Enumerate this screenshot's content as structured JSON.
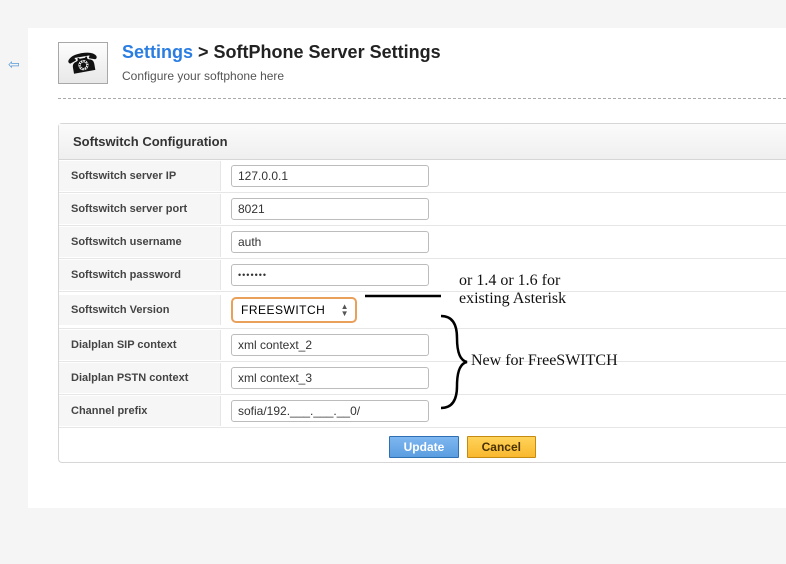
{
  "nav": {
    "back_icon": "⇦"
  },
  "header": {
    "breadcrumb_link": "Settings",
    "breadcrumb_sep": " > ",
    "breadcrumb_page": "SoftPhone Server Settings",
    "subtitle": "Configure your softphone here",
    "icon": "phone-icon"
  },
  "panel": {
    "title": "Softswitch Configuration"
  },
  "fields": {
    "server_ip": {
      "label": "Softswitch server IP",
      "value": "127.0.0.1"
    },
    "server_port": {
      "label": "Softswitch server port",
      "value": "8021"
    },
    "username": {
      "label": "Softswitch username",
      "value": "auth"
    },
    "password": {
      "label": "Softswitch password",
      "value": "•••••••"
    },
    "version": {
      "label": "Softswitch Version",
      "value": "FREESWITCH"
    },
    "sip_ctx": {
      "label": "Dialplan SIP context",
      "value": "xml context_2"
    },
    "pstn_ctx": {
      "label": "Dialplan PSTN context",
      "value": "xml context_3"
    },
    "chan_prefix": {
      "label": "Channel prefix",
      "value": "sofia/192.___.___.__0/"
    }
  },
  "buttons": {
    "update": "Update",
    "cancel": "Cancel"
  },
  "annotations": {
    "version_note_l1": "or 1.4 or 1.6 for",
    "version_note_l2": "existing Asterisk",
    "new_note": "New for FreeSWITCH"
  }
}
